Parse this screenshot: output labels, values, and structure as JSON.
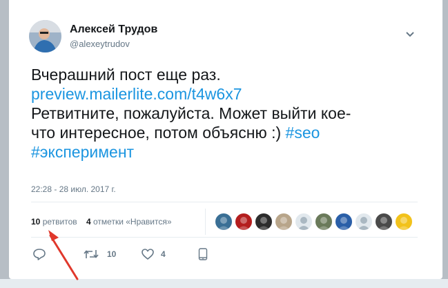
{
  "author": {
    "name": "Алексей Трудов",
    "handle": "@alexeytrudov"
  },
  "tweet": {
    "line1": "Вчерашний пост еще раз.",
    "link": "preview.mailerlite.com/t4w6x7",
    "line3": "Ретвитните, пожалуйста. Может выйти кое-",
    "line4": "что интересное, потом объясню :) ",
    "hashtag1": "#seo",
    "hashtag2": "#эксперимент",
    "timestamp": "22:28 - 28 июл. 2017 г."
  },
  "stats": {
    "retweets_count": "10",
    "retweets_label": "ретвитов",
    "likes_count": "4",
    "likes_label": "отметки «Нравится»"
  },
  "likers": [
    {
      "icon": "liker-avatar",
      "color": "#3a6f95"
    },
    {
      "icon": "liker-avatar",
      "color": "#b41e1e"
    },
    {
      "icon": "liker-avatar",
      "color": "#2d2d2d"
    },
    {
      "icon": "liker-avatar",
      "color": "#b8a58a"
    },
    {
      "icon": "default-avatar",
      "color": "#aab8c2"
    },
    {
      "icon": "liker-avatar",
      "color": "#6a7a5a"
    },
    {
      "icon": "liker-avatar",
      "color": "#2a5fa8"
    },
    {
      "icon": "default-avatar",
      "color": "#aab8c2"
    },
    {
      "icon": "liker-avatar",
      "color": "#4a4a4a"
    },
    {
      "icon": "liker-avatar",
      "color": "#f2c21b"
    }
  ],
  "actions": {
    "reply_count": "",
    "retweet_count": "10",
    "like_count": "4"
  },
  "colors": {
    "link": "#1b95e0",
    "annotation_arrow": "#e0382c"
  }
}
